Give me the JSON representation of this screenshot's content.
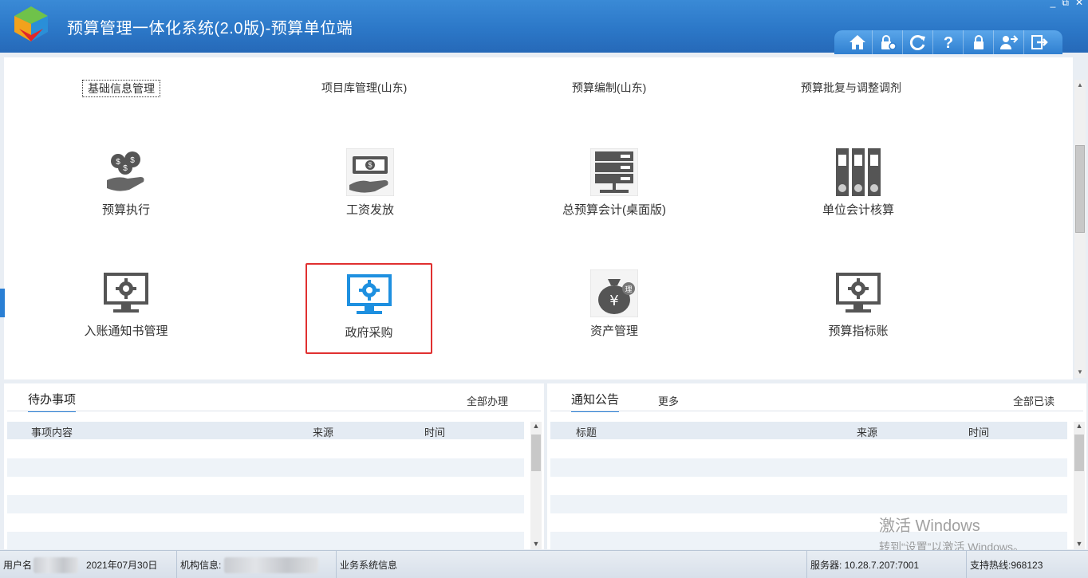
{
  "app": {
    "title": "预算管理一体化系统(2.0版)-预算单位端",
    "window_controls": [
      "_",
      "⧉",
      "✕"
    ]
  },
  "toolbar": {
    "items": [
      {
        "name": "home-icon",
        "glyph": "⌂"
      },
      {
        "name": "lock-settings-icon",
        "glyph": "🔒"
      },
      {
        "name": "refresh-icon",
        "glyph": "⟳"
      },
      {
        "name": "help-icon",
        "glyph": "?"
      },
      {
        "name": "lock-icon",
        "glyph": "🔒"
      },
      {
        "name": "user-switch-icon",
        "glyph": "👥"
      },
      {
        "name": "exit-icon",
        "glyph": "⇥"
      }
    ]
  },
  "top_tabs": [
    "基础信息管理",
    "项目库管理(山东)",
    "预算编制(山东)",
    "预算批复与调整调剂"
  ],
  "modules": [
    {
      "label": "预算执行",
      "icon": "money-hand-icon"
    },
    {
      "label": "工资发放",
      "icon": "cash-payout-icon"
    },
    {
      "label": "总预算会计(桌面版)",
      "icon": "server-icon"
    },
    {
      "label": "单位会计核算",
      "icon": "binders-icon"
    },
    {
      "label": "入账通知书管理",
      "icon": "monitor-gear-icon"
    },
    {
      "label": "政府采购",
      "icon": "monitor-gear-blue-icon"
    },
    {
      "label": "资产管理",
      "icon": "money-bag-icon"
    },
    {
      "label": "预算指标账",
      "icon": "monitor-gear-icon"
    }
  ],
  "todo_panel": {
    "tab": "待办事项",
    "action": "全部办理",
    "columns": [
      "事项内容",
      "来源",
      "时间"
    ]
  },
  "notice_panel": {
    "tab": "通知公告",
    "more": "更多",
    "action": "全部已读",
    "columns": [
      "标题",
      "来源",
      "时间"
    ]
  },
  "watermark": {
    "line1": "激活 Windows",
    "line2": "转到“设置”以激活 Windows。"
  },
  "status": {
    "user_label": "用户名",
    "date": "2021年07月30日",
    "org_label": "机构信息:",
    "system_info": "业务系统信息",
    "server": "服务器: 10.28.7.207:7001",
    "hotline": "支持热线:968123"
  },
  "colors": {
    "title_bar": "#2c78c8",
    "accent": "#2a7fd4",
    "selection_border": "#e03030"
  }
}
